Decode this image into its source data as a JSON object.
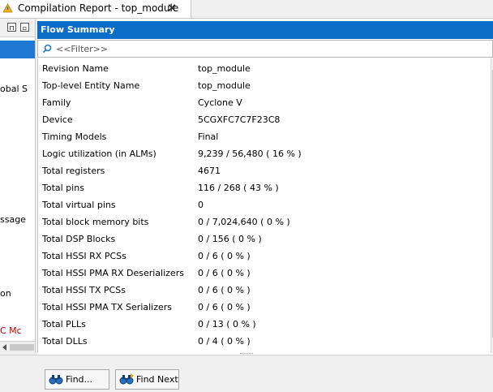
{
  "tab": {
    "title": "Compilation Report - top_module"
  },
  "left_panel": {
    "fragments": [
      {
        "text": "obal S",
        "color": "#000000"
      },
      {
        "text": "ssage",
        "color": "#000000"
      },
      {
        "text": "on",
        "color": "#000000"
      },
      {
        "text": "C Mc",
        "color": "#c00000"
      }
    ]
  },
  "report": {
    "header": "Flow Summary",
    "filter_placeholder": "<<Filter>>",
    "rows": [
      {
        "name": "Revision Name",
        "value": "top_module"
      },
      {
        "name": "Top-level Entity Name",
        "value": "top_module"
      },
      {
        "name": "Family",
        "value": "Cyclone V"
      },
      {
        "name": "Device",
        "value": "5CGXFC7C7F23C8"
      },
      {
        "name": "Timing Models",
        "value": "Final"
      },
      {
        "name": "Logic utilization (in ALMs)",
        "value": "9,239 / 56,480 ( 16 % )"
      },
      {
        "name": "Total registers",
        "value": "4671"
      },
      {
        "name": "Total pins",
        "value": "116 / 268 ( 43 % )"
      },
      {
        "name": "Total virtual pins",
        "value": "0"
      },
      {
        "name": "Total block memory bits",
        "value": "0 / 7,024,640 ( 0 % )"
      },
      {
        "name": "Total DSP Blocks",
        "value": "0 / 156 ( 0 % )"
      },
      {
        "name": "Total HSSI RX PCSs",
        "value": "0 / 6 ( 0 % )"
      },
      {
        "name": "Total HSSI PMA RX Deserializers",
        "value": "0 / 6 ( 0 % )"
      },
      {
        "name": "Total HSSI TX PCSs",
        "value": "0 / 6 ( 0 % )"
      },
      {
        "name": "Total HSSI PMA TX Serializers",
        "value": "0 / 6 ( 0 % )"
      },
      {
        "name": "Total PLLs",
        "value": "0 / 13 ( 0 % )"
      },
      {
        "name": "Total DLLs",
        "value": "0 / 4 ( 0 % )"
      }
    ]
  },
  "buttons": {
    "find": "Find...",
    "find_next": "Find Next"
  },
  "colors": {
    "header_bg": "#0b6dc8",
    "selection": "#1e78d4",
    "error_text": "#c00000"
  }
}
